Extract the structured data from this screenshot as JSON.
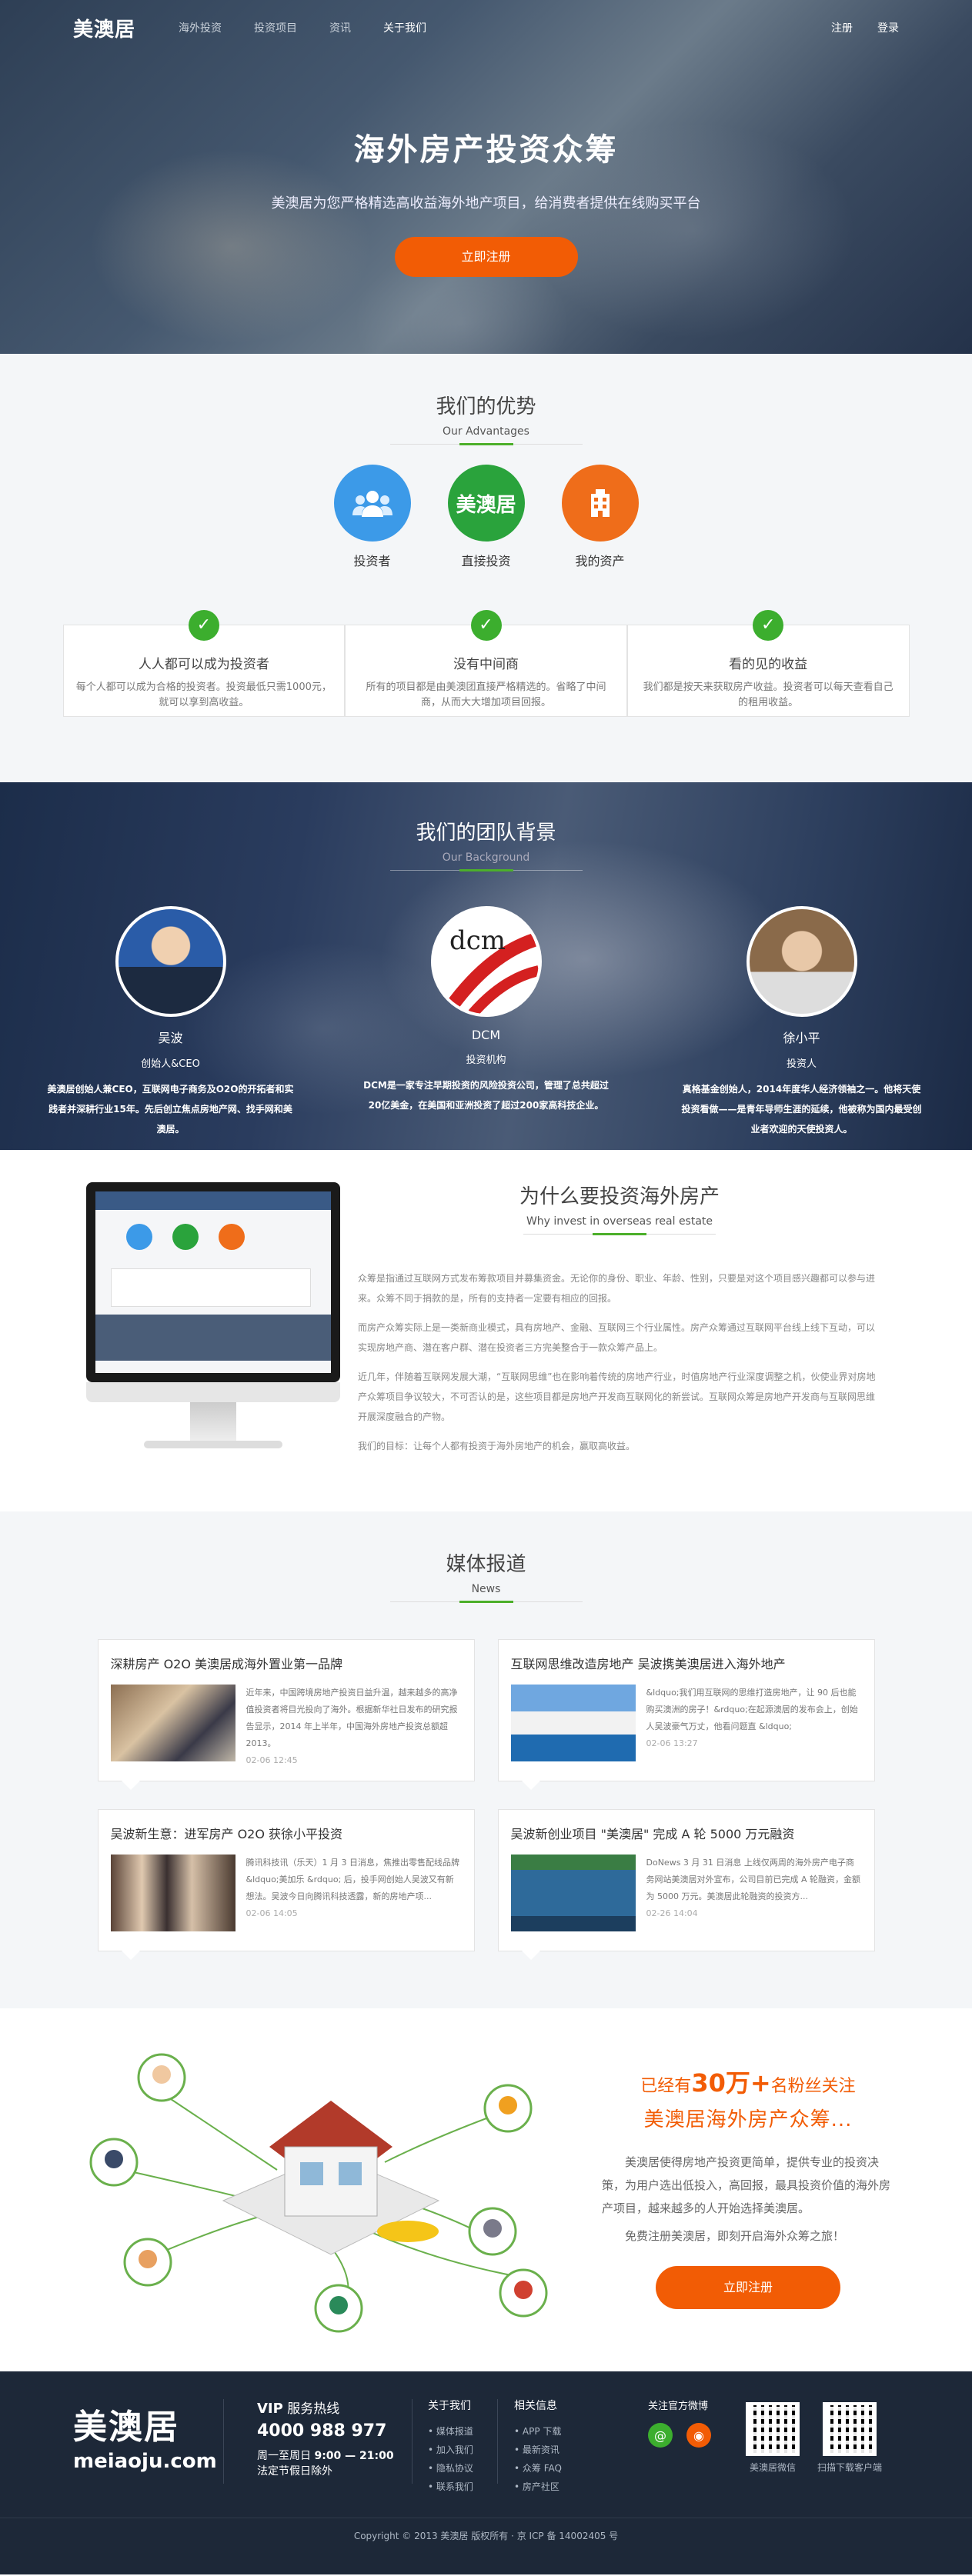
{
  "nav": {
    "logo": "美澳居",
    "links": [
      "海外投资",
      "投资项目",
      "资讯",
      "关于我们"
    ],
    "register": "注册",
    "login": "登录"
  },
  "hero": {
    "title": "海外房产投资众筹",
    "subtitle": "美澳居为您严格精选高收益海外地产项目，给消费者提供在线购买平台",
    "button": "立即注册"
  },
  "advantages": {
    "title": "我们的优势",
    "en": "Our Advantages",
    "icons": [
      {
        "label": "投资者",
        "icon": "investors-icon"
      },
      {
        "label": "直接投资",
        "icon": "brand-logo-icon",
        "text": "美澳居"
      },
      {
        "label": "我的资产",
        "icon": "building-icon"
      }
    ],
    "cards": [
      {
        "title": "人人都可以成为投资者",
        "desc": "每个人都可以成为合格的投资者。投资最低只需1000元，就可以享到高收益。"
      },
      {
        "title": "没有中间商",
        "desc": "所有的项目都是由美澳团直接严格精选的。省略了中间商，从而大大增加项目回报。"
      },
      {
        "title": "看的见的收益",
        "desc": "我们都是按天来获取房产收益。投资者可以每天查看自己的租用收益。"
      }
    ]
  },
  "team": {
    "title": "我们的团队背景",
    "en": "Our Background",
    "members": [
      {
        "name": "吴波",
        "role": "创始人&CEO",
        "desc": "美澳居创始人兼CEO，互联网电子商务及O2O的开拓者和实践者并深耕行业15年。先后创立焦点房地产网、找手网和美澳居。"
      },
      {
        "name": "DCM",
        "role": "投资机构",
        "desc": "DCM是一家专注早期投资的风险投资公司，管理了总共超过20亿美金，在美国和亚洲投资了超过200家高科技企业。"
      },
      {
        "name": "徐小平",
        "role": "投资人",
        "desc": "真格基金创始人，2014年度华人经济领袖之一。他将天使投资看做——是青年导师生涯的延续，他被称为国内最受创业者欢迎的天使投资人。"
      }
    ]
  },
  "why": {
    "title": "为什么要投资海外房产",
    "en": "Why invest in overseas real estate",
    "paras": [
      "众筹是指通过互联网方式发布筹款项目并募集资金。无论你的身份、职业、年龄、性别，只要是对这个项目感兴趣都可以参与进来。众筹不同于捐款的是，所有的支持者一定要有相应的回报。",
      "而房产众筹实际上是一类新商业模式，具有房地产、金融、互联网三个行业属性。房产众筹通过互联网平台线上线下互动，可以实现房地产商、潜在客户群、潜在投资者三方完美整合于一款众筹产品上。",
      "近几年，伴随着互联网发展大潮，“互联网思维”也在影响着传统的房地产行业，时值房地产行业深度调整之机，伙使业界对房地产众筹项目争议较大，不可否认的是，这些项目都是房地产开发商互联网化的新尝试。互联网众筹是房地产开发商与互联网思维开展深度融合的产物。",
      "我们的目标：让每个人都有投资于海外房地产的机会，赢取高收益。"
    ]
  },
  "news": {
    "title": "媒体报道",
    "en": "News",
    "items": [
      {
        "title": "深耕房产 O2O 美澳居成海外置业第一品牌",
        "text": "近年来，中国跨境房地产投资日益升温，越来越多的高净值投资者将目光投向了海外。根据新华社日发布的研究报告显示，2014 年上半年，中国海外房地产投资总额超 2013。",
        "date": "02-06 12:45"
      },
      {
        "title": "互联网思维改造房地产 吴波携美澳居进入海外地产",
        "text": "&ldquo;我们用互联网的思维打造房地产，让 90 后也能购买澳洲的房子！&rdquo;在起源澳居的发布会上，创始人吴波豪气万丈，他看问题直 &ldquo;",
        "date": "02-06 13:27"
      },
      {
        "title": "吴波新生意：进军房产 O2O 获徐小平投资",
        "text": "腾讯科技讯（乐天）1 月 3 日消息，焦推出零售配线品牌 &ldquo;美加乐 &rdquo; 后，投手网创始人吴波又有新想法。吴波今日向腾讯科技透露，新的房地产项...",
        "date": "02-06 14:05"
      },
      {
        "title": "吴波新创业项目 \"美澳居\" 完成 A 轮 5000 万元融资",
        "text": "DoNews 3 月 31 日消息 上线仅两周的海外房产电子商务网站美澳居对外宣布，公司目前已完成 A 轮融资，金额为 5000 万元。美澳居此轮融资的投资方...",
        "date": "02-26 14:04"
      }
    ]
  },
  "join": {
    "line1_pre": "已经有",
    "line1_num": "30万+",
    "line1_post": "名粉丝关注",
    "line2": "美澳居海外房产众筹...",
    "p1": "美澳居使得房地产投资更简单，提供专业的投资决策，为用户选出低投入，高回报，最具投资价值的海外房产项目，越来越多的人开始选择美澳居。",
    "p2": "免费注册美澳居，即刻开启海外众筹之旅！",
    "button": "立即注册"
  },
  "footer": {
    "logo_cn": "美澳居",
    "logo_en": "meiaoju.com",
    "vip": "VIP",
    "vip_label": "服务热线",
    "phone": "4000 988 977",
    "hours_pre": "周一至周日",
    "hours": "9:00 — 21:00",
    "holiday": "法定节假日除外",
    "about_title": "关于我们",
    "about": [
      "媒体报道",
      "加入我们",
      "隐私协议",
      "联系我们"
    ],
    "info_title": "相关信息",
    "info": [
      "APP 下载",
      "最新资讯",
      "众筹 FAQ",
      "房产社区"
    ],
    "follow": "关注官方微博",
    "qr1": "美澳居微信",
    "qr2": "扫描下载客户端",
    "copyright": "Copyright © 2013 美澳居 版权所有 · 京 ICP 备 14002405 号"
  },
  "colors": {
    "accent": "#f25c05",
    "green": "#4caf2a",
    "footer": "#1d2838"
  }
}
